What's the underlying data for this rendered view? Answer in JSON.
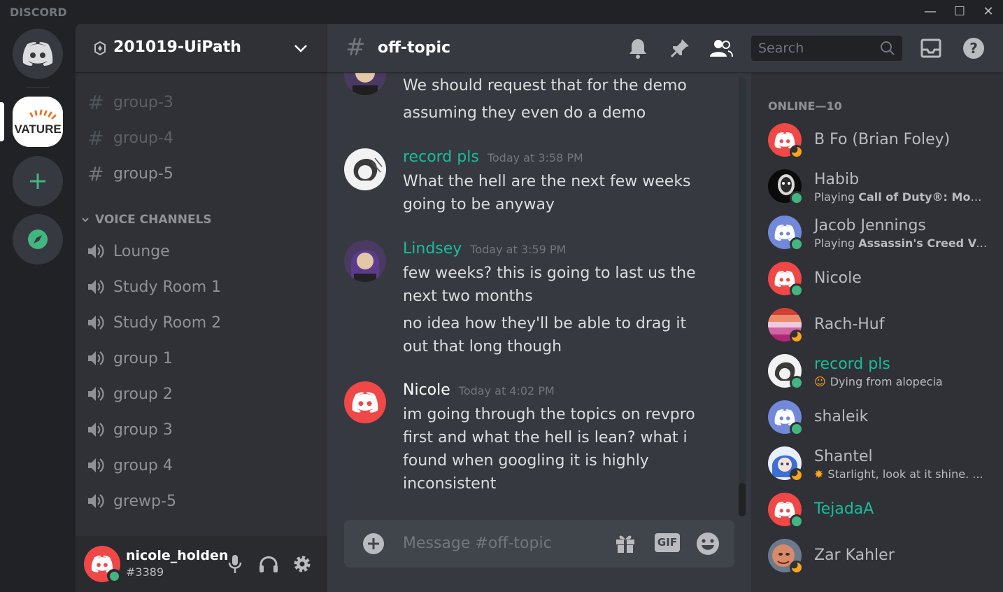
{
  "app": {
    "brand": "DISCORD"
  },
  "window_controls": {
    "minimize": "—",
    "maximize": "☐",
    "close": "✕"
  },
  "rail": {
    "vature_label": "VATURE"
  },
  "guild": {
    "name": "201019-UiPath"
  },
  "text_channels": [
    {
      "name": "group-3"
    },
    {
      "name": "group-4"
    },
    {
      "name": "group-5"
    }
  ],
  "voice_category": "VOICE CHANNELS",
  "voice_channels": [
    {
      "name": "Lounge"
    },
    {
      "name": "Study Room 1"
    },
    {
      "name": "Study Room 2"
    },
    {
      "name": "group 1"
    },
    {
      "name": "group 2"
    },
    {
      "name": "group 3"
    },
    {
      "name": "group 4"
    },
    {
      "name": "grewp-5"
    }
  ],
  "user": {
    "name": "nicole_holden",
    "discriminator": "#3389"
  },
  "channel": {
    "hash": "#",
    "name": "off-topic"
  },
  "search": {
    "placeholder": "Search"
  },
  "messages": [
    {
      "lines": [
        "We should request that for the demo",
        "assuming they even do a demo"
      ]
    },
    {
      "author": "record pls",
      "author_color": "#1abc9c",
      "time": "Today at 3:58 PM",
      "lines": [
        "What the hell are the next few weeks going to be anyway"
      ]
    },
    {
      "author": "Lindsey",
      "author_color": "#1abc9c",
      "time": "Today at 3:59 PM",
      "lines": [
        "few weeks? this is going to last us the next two months",
        "no idea how they'll be able to drag it out that long though"
      ]
    },
    {
      "author": "Nicole",
      "author_color": "#ffffff",
      "time": "Today at 4:02 PM",
      "lines": [
        "im going through the topics on revpro first and what the hell is lean? what i found when googling it is highly inconsistent"
      ]
    }
  ],
  "composer": {
    "placeholder": "Message #off-topic",
    "gif_label": "GIF"
  },
  "members": {
    "category": "ONLINE—10",
    "list": [
      {
        "name": "B Fo (Brian Foley)",
        "status": "idle",
        "avatar": "discord-red"
      },
      {
        "name": "Habib",
        "status": "online",
        "activity_prefix": "Playing ",
        "activity": "Call of Duty®: Modern ...",
        "avatar": "photo-dark"
      },
      {
        "name": "Jacob Jennings",
        "status": "online",
        "activity_prefix": "Playing ",
        "activity": "Assassin's Creed Valh...",
        "avatar": "discord-blurple"
      },
      {
        "name": "Nicole",
        "status": "online",
        "avatar": "discord-red"
      },
      {
        "name": "Rach-Huf",
        "status": "idle",
        "avatar": "stripes"
      },
      {
        "name": "record pls",
        "name_color": "#1abc9c",
        "status": "online",
        "custom_status": "Dying from alopecia",
        "emoji": "☺",
        "avatar": "sketch"
      },
      {
        "name": "shaleik",
        "status": "online",
        "avatar": "discord-blurple"
      },
      {
        "name": "Shantel",
        "status": "idle",
        "custom_status": "Starlight, look at it shine. ...",
        "emoji": "✸",
        "avatar": "anime"
      },
      {
        "name": "TejadaA",
        "name_color": "#1abc9c",
        "status": "online",
        "avatar": "discord-red"
      },
      {
        "name": "Zar Kahler",
        "status": "idle",
        "avatar": "photo-face"
      }
    ]
  },
  "colors": {
    "accent": "#5865f2",
    "online": "#43b581",
    "idle": "#faa61a",
    "red": "#f04747",
    "teal": "#1abc9c"
  }
}
